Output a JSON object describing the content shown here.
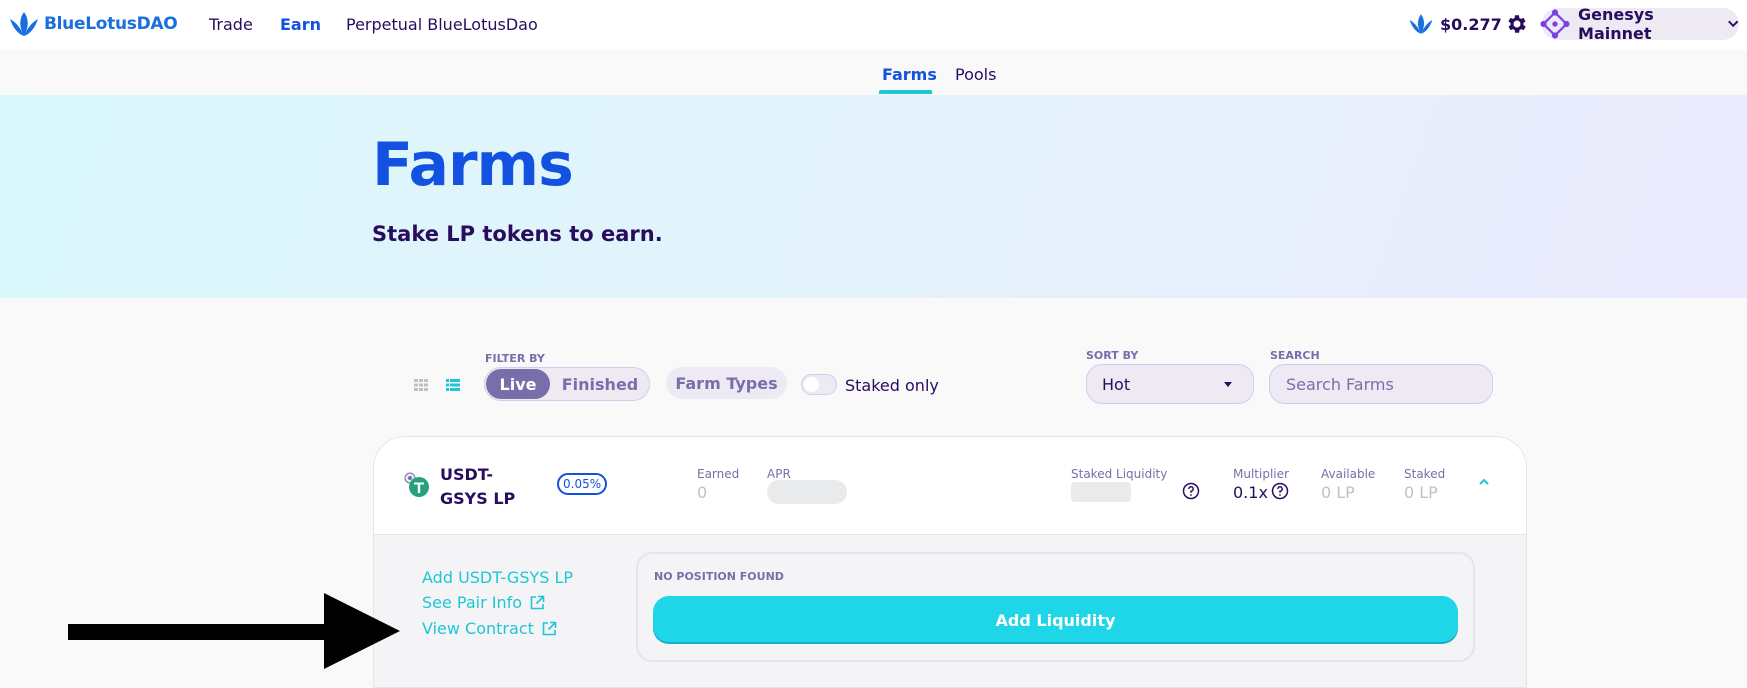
{
  "header": {
    "logo_text": "BlueLotusDAO",
    "nav": [
      "Trade",
      "Earn",
      "Perpetual BlueLotusDao"
    ],
    "active_nav": "Earn",
    "token_price": "$0.277",
    "network": "Genesys Mainnet"
  },
  "subnav": {
    "tabs": [
      "Farms",
      "Pools"
    ],
    "active": "Farms"
  },
  "hero": {
    "title": "Farms",
    "subtitle": "Stake LP tokens to earn."
  },
  "controls": {
    "filter_by_label": "FILTER BY",
    "filter_options": [
      "Live",
      "Finished"
    ],
    "filter_active": "Live",
    "farm_types_label": "Farm Types",
    "staked_only_label": "Staked only",
    "staked_only_on": false,
    "sort_by_label": "SORT BY",
    "sort_value": "Hot",
    "search_label": "SEARCH",
    "search_placeholder": "Search Farms",
    "view_mode": "list"
  },
  "farm": {
    "name": "USDT-GSYS LP",
    "fee_badge": "0.05%",
    "earned_label": "Earned",
    "earned_value": "0",
    "apr_label": "APR",
    "staked_liquidity_label": "Staked Liquidity",
    "multiplier_label": "Multiplier",
    "multiplier_value": "0.1x",
    "available_label": "Available",
    "available_value": "0 LP",
    "staked_label": "Staked",
    "staked_value": "0 LP",
    "links": [
      "Add USDT-GSYS LP",
      "See Pair Info",
      "View Contract"
    ],
    "no_position_label": "NO POSITION FOUND",
    "add_liquidity_label": "Add Liquidity"
  },
  "colors": {
    "primary": "#1352e0",
    "accent": "#1fc7d4",
    "text": "#280d5f",
    "secondary": "#7a6eaa"
  }
}
